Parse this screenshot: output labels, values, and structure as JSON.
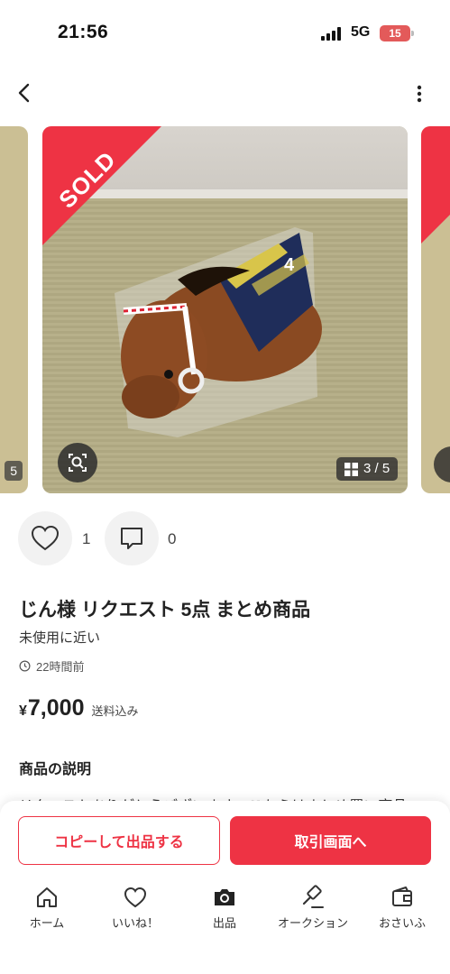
{
  "status_bar": {
    "time": "21:56",
    "network": "5G",
    "battery": "15"
  },
  "nav": {
    "back_icon": "chevron-left-icon",
    "more_icon": "more-vertical-icon"
  },
  "gallery": {
    "sold_label": "SOLD",
    "counter": "3 / 5",
    "prev_counter": "5"
  },
  "reactions": {
    "likes": "1",
    "comments": "0"
  },
  "product": {
    "title": "じん様 リクエスト 5点 まとめ商品",
    "condition": "未使用に近い",
    "posted": "22時間前",
    "price_symbol": "¥",
    "price": "7,000",
    "shipping": "送料込み"
  },
  "description": {
    "heading": "商品の説明",
    "text": "リクエストありがとうございます。こちらはまとめ買い商品"
  },
  "actions": {
    "copy_label": "コピーして出品する",
    "trade_label": "取引画面へ"
  },
  "tabs": [
    {
      "label": "ホーム",
      "icon": "home-icon"
    },
    {
      "label": "いいね！",
      "icon": "heart-icon"
    },
    {
      "label": "出品",
      "icon": "camera-icon"
    },
    {
      "label": "オークション",
      "icon": "gavel-icon"
    },
    {
      "label": "おさいふ",
      "icon": "wallet-icon"
    }
  ],
  "colors": {
    "accent": "#ee3344",
    "text": "#222222",
    "muted": "#555555"
  }
}
